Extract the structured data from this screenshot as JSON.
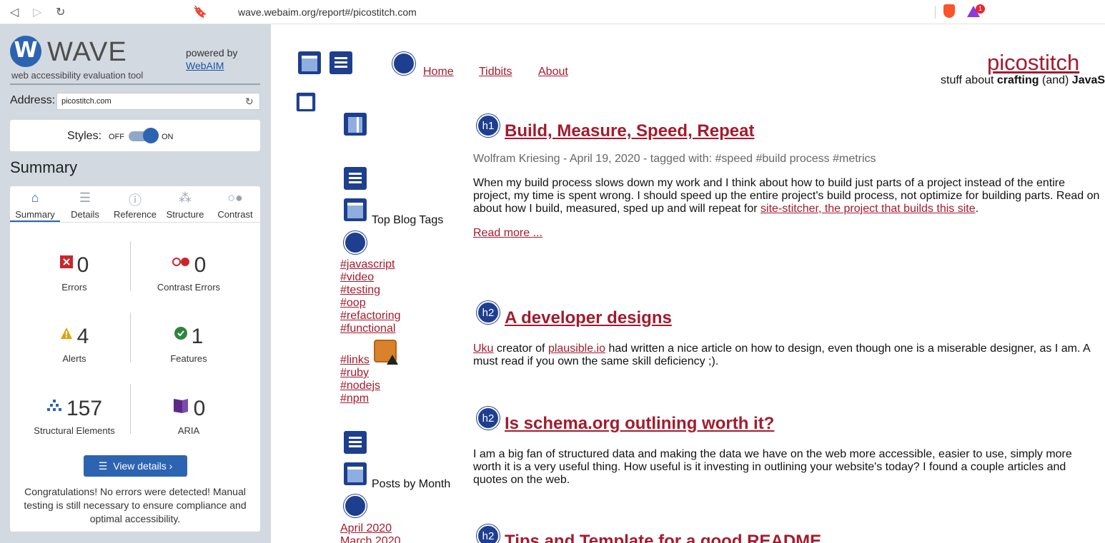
{
  "browser": {
    "url": "wave.webaim.org/report#/picostitch.com",
    "brave_badge": "1"
  },
  "wave": {
    "title": "WAVE",
    "subtitle": "web accessibility evaluation tool",
    "powered_by": "powered by",
    "webaim": "WebAIM",
    "address_label": "Address:",
    "address_value": "picostitch.com",
    "styles_label": "Styles:",
    "styles_off": "OFF",
    "styles_on": "ON",
    "summary_heading": "Summary",
    "tabs": [
      {
        "label": "Summary",
        "icon": "home-icon"
      },
      {
        "label": "Details",
        "icon": "list-icon"
      },
      {
        "label": "Reference",
        "icon": "info-icon"
      },
      {
        "label": "Structure",
        "icon": "structure-icon"
      },
      {
        "label": "Contrast",
        "icon": "contrast-icon"
      }
    ],
    "stats": {
      "errors": {
        "value": "0",
        "label": "Errors",
        "color": "#c9262c"
      },
      "contrast_errors": {
        "value": "0",
        "label": "Contrast Errors",
        "color": "#c9262c"
      },
      "alerts": {
        "value": "4",
        "label": "Alerts",
        "color": "#e5a00d"
      },
      "features": {
        "value": "1",
        "label": "Features",
        "color": "#2e8540"
      },
      "structural": {
        "value": "157",
        "label": "Structural Elements",
        "color": "#2c64b1"
      },
      "aria": {
        "value": "0",
        "label": "ARIA",
        "color": "#5b2a86"
      }
    },
    "view_details": "View details ›",
    "congrats": "Congratulations! No errors were detected! Manual testing is still necessary to ensure compliance and optimal accessibility."
  },
  "site": {
    "nav": [
      "Home",
      "Tidbits",
      "About"
    ],
    "title": "picostitch",
    "tagline_pre": "stuff about ",
    "tagline_b1": "crafting",
    "tagline_mid": " (and) ",
    "tagline_b2": "JavaS",
    "top_blog_tags": "Top Blog Tags",
    "tags_a": [
      "#javascript",
      "#video",
      "#testing",
      "#oop",
      "#refactoring",
      "#functional"
    ],
    "tags_b": [
      "#links",
      "#ruby",
      "#nodejs",
      "#npm"
    ],
    "posts_by_month": "Posts by Month",
    "months": [
      "April 2020",
      "March 2020"
    ],
    "posts": [
      {
        "badge": "h1",
        "title": "Build, Measure, Speed, Repeat",
        "meta": "Wolfram Kriesing - April 19, 2020 - tagged with: #speed #build process #metrics",
        "text": "When my build process slows down my work and I think about how to build just parts of a project instead of the entire project, my time is spent wrong. I should speed up the entire project's build process, not optimize for building parts. Read on about how I build, measured, sped up and will repeat for ",
        "link": "site-stitcher, the project that builds this site",
        "text_end": ".",
        "read_more": "Read more ..."
      },
      {
        "badge": "h2",
        "title": " A developer designs",
        "link1": "Uku",
        "text1": " creator of ",
        "link2": "plausible.io",
        "text2": " had written a nice article on how to design, even though one is a miserable designer, as I am. A must read if you own the same skill deficiency ;)."
      },
      {
        "badge": "h2",
        "title": " Is schema.org outlining worth it?",
        "text": "I am a big fan of structured data and making the data we have on the web more accessible, easier to use, simply more worth it is a very useful thing. How useful is it investing in outlining your website's today? I found a couple articles and quotes on the web."
      },
      {
        "badge": "h2",
        "title": " Tips and Template for a good README"
      }
    ]
  }
}
